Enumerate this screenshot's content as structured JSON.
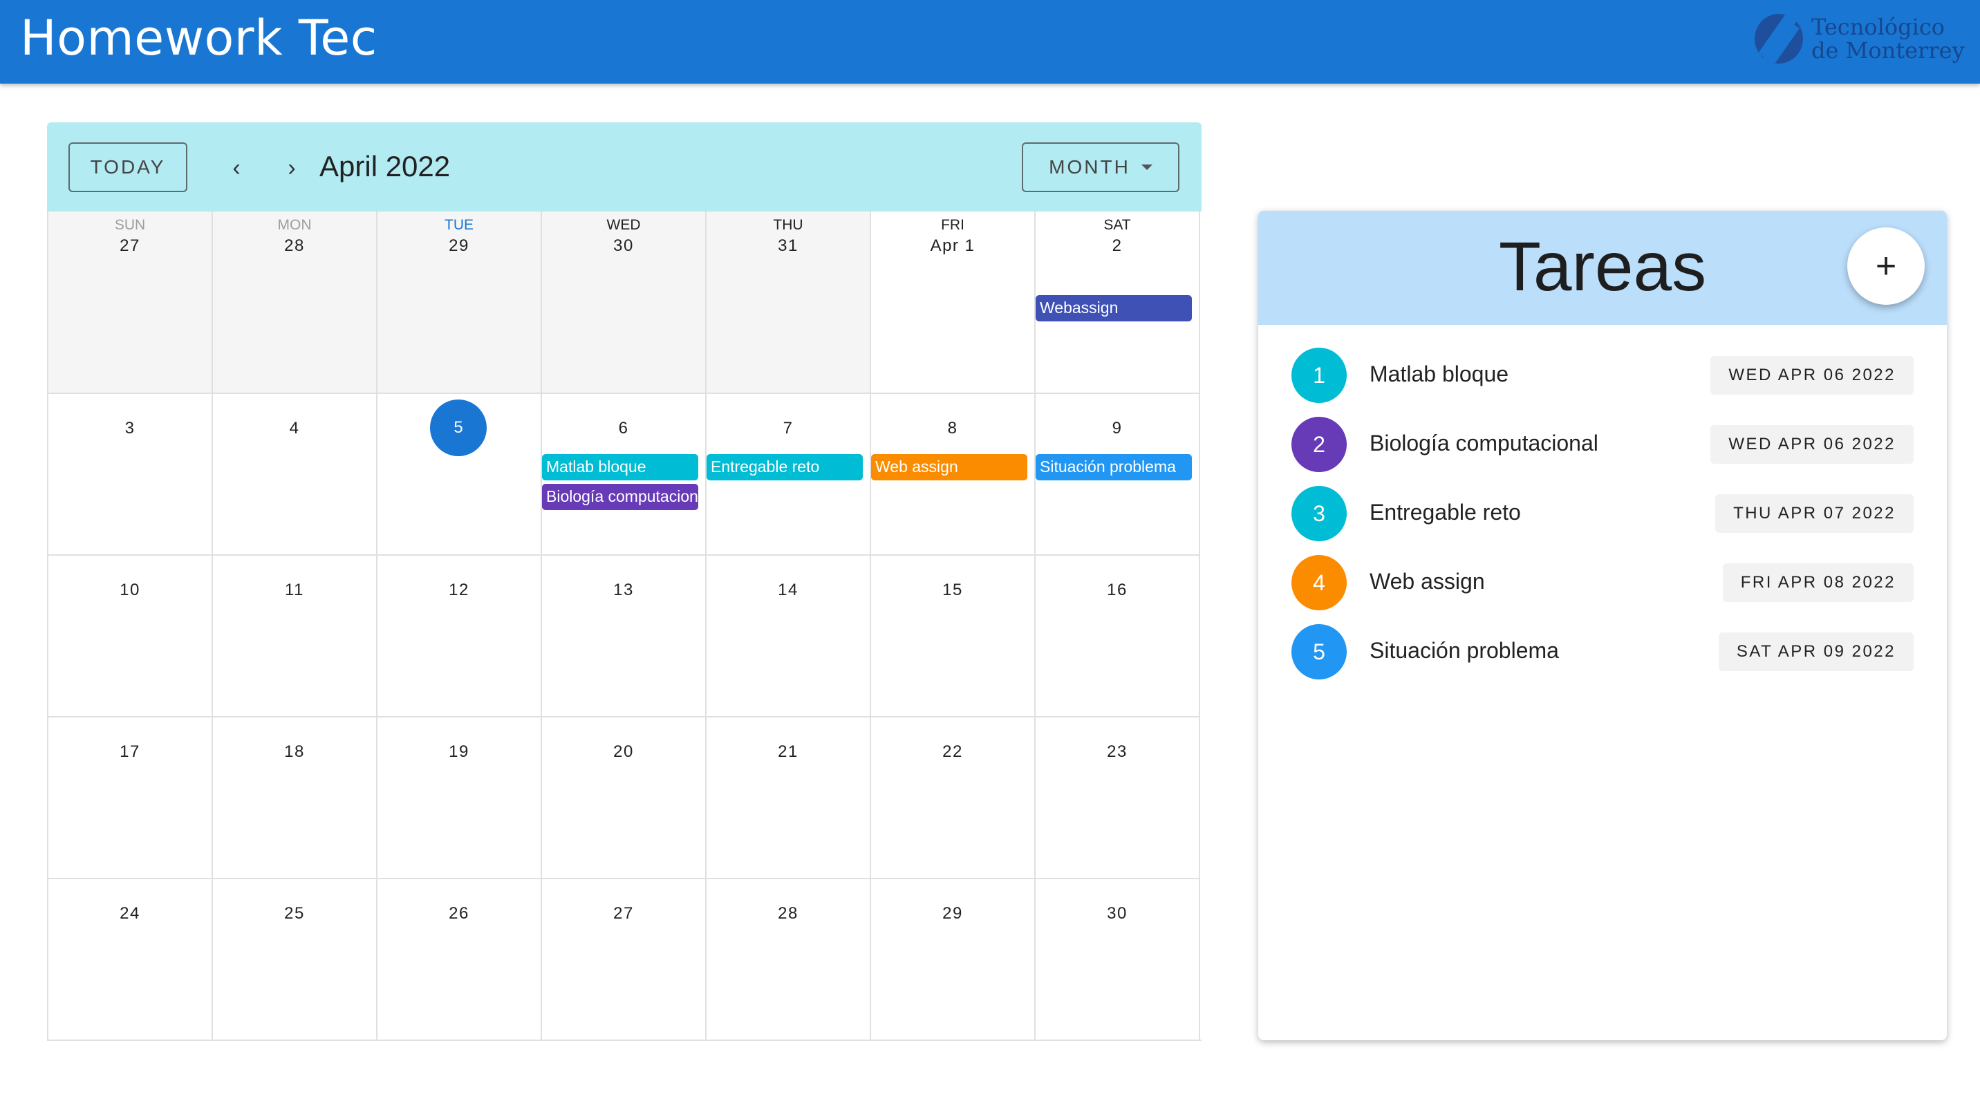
{
  "app": {
    "title": "Homework Tec",
    "logo_line1": "Tecnológico",
    "logo_line2": "de Monterrey"
  },
  "calendar": {
    "today_label": "TODAY",
    "prev_icon": "chevron-left-icon",
    "next_icon": "chevron-right-icon",
    "title": "April 2022",
    "view_label": "MONTH",
    "weekdays": [
      "SUN",
      "MON",
      "TUE",
      "WED",
      "THU",
      "FRI",
      "SAT"
    ],
    "weeks": [
      [
        "27",
        "28",
        "29",
        "30",
        "31",
        "Apr 1",
        "2"
      ],
      [
        "3",
        "4",
        "5",
        "6",
        "7",
        "8",
        "9"
      ],
      [
        "10",
        "11",
        "12",
        "13",
        "14",
        "15",
        "16"
      ],
      [
        "17",
        "18",
        "19",
        "20",
        "21",
        "22",
        "23"
      ],
      [
        "24",
        "25",
        "26",
        "27",
        "28",
        "29",
        "30"
      ]
    ],
    "events": {
      "webassign": "Webassign",
      "matlab": "Matlab bloque",
      "biologia": "Biología computacional",
      "entregable": "Entregable reto",
      "web_assign": "Web assign",
      "situacion": "Situación problema"
    },
    "colors": {
      "indigo": "#3f51b5",
      "cyan": "#00bcd4",
      "purple": "#673ab7",
      "orange": "#fb8c00",
      "blue": "#2196f3",
      "primary": "#1976d2"
    }
  },
  "tareas": {
    "title": "Tareas",
    "add_icon": "plus-icon",
    "items": [
      {
        "num": "1",
        "label": "Matlab bloque",
        "date": "WED APR 06 2022"
      },
      {
        "num": "2",
        "label": "Biología computacional",
        "date": "WED APR 06 2022"
      },
      {
        "num": "3",
        "label": "Entregable reto",
        "date": "THU APR 07 2022"
      },
      {
        "num": "4",
        "label": "Web assign",
        "date": "FRI APR 08 2022"
      },
      {
        "num": "5",
        "label": "Situación problema",
        "date": "SAT APR 09 2022"
      }
    ]
  }
}
